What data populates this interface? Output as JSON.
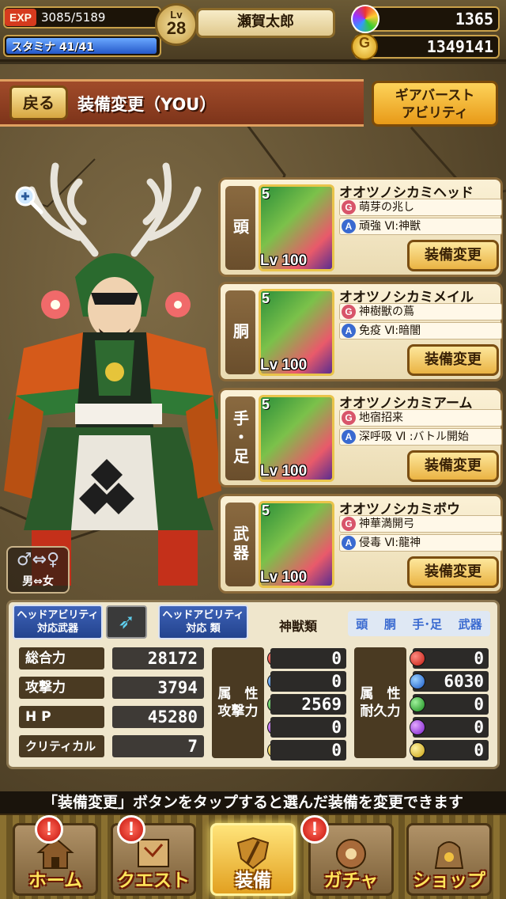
{
  "status": {
    "exp_label": "EXP",
    "exp_text": "3085/5189",
    "stamina_label": "スタミナ",
    "stamina_text": "41/41",
    "level_label": "Lv",
    "level": "28",
    "player_name": "瀬賀太郎",
    "gems": "1365",
    "coin_symbol": "G",
    "coins": "1349141",
    "stamina_fraction": 1.0
  },
  "header": {
    "back_label": "戻る",
    "title": "装備変更（YOU）",
    "gearburst_line1": "ギアバースト",
    "gearburst_line2": "アビリティ"
  },
  "character": {
    "gender_icon": "♂⇔♀",
    "gender_label": "男⇔女"
  },
  "equipment": [
    {
      "slot": "頭",
      "name": "オオツノシカミヘッド",
      "skill_g": "萌芽の兆し",
      "skill_a": "頑強 Ⅵ:神獣",
      "level": "Lv 100",
      "rarity": "5",
      "button": "装備変更"
    },
    {
      "slot": "胴",
      "name": "オオツノシカミメイル",
      "skill_g": "神樹獣の蔦",
      "skill_a": "免疫 Ⅵ:暗闇",
      "level": "Lv 100",
      "rarity": "5",
      "button": "装備変更"
    },
    {
      "slot": "手・足",
      "name": "オオツノシカミアーム",
      "skill_g": "地宿招来",
      "skill_a": "深呼吸 Ⅵ :バトル開始",
      "level": "Lv 100",
      "rarity": "5",
      "button": "装備変更"
    },
    {
      "slot": "武器",
      "name": "オオツノシカミボウ",
      "skill_g": "神華満開弓",
      "skill_a": "侵毒 Ⅵ:龍神",
      "level": "Lv 100",
      "rarity": "5",
      "button": "装備変更"
    }
  ],
  "ability": {
    "head_weapon_line1": "ヘッドアビリティ",
    "head_weapon_line2": "対応武器",
    "head_type_line1": "ヘッドアビリティ",
    "head_type_line2": "対応 類",
    "type_value": "神獣類",
    "filters": [
      "頭",
      "胴",
      "手･足",
      "武器"
    ]
  },
  "stats": [
    {
      "label": "総合力",
      "value": "28172"
    },
    {
      "label": "攻撃力",
      "value": "3794"
    },
    {
      "label": "H P",
      "value": "45280"
    },
    {
      "label": "クリティカル",
      "value": "7"
    }
  ],
  "attack_attr": {
    "line1": "属　性",
    "line2": "攻撃力",
    "values": [
      "0",
      "0",
      "2569",
      "0",
      "0"
    ]
  },
  "defense_attr": {
    "line1": "属　性",
    "line2": "耐久力",
    "values": [
      "0",
      "6030",
      "0",
      "0",
      "0"
    ]
  },
  "hint": "「装備変更」ボタンをタップすると選んだ装備を変更できます",
  "nav": [
    {
      "label": "ホーム",
      "alert": "!"
    },
    {
      "label": "クエスト",
      "alert": "!"
    },
    {
      "label": "装備",
      "alert": ""
    },
    {
      "label": "ガチャ",
      "alert": "!"
    },
    {
      "label": "ショップ",
      "alert": ""
    }
  ]
}
